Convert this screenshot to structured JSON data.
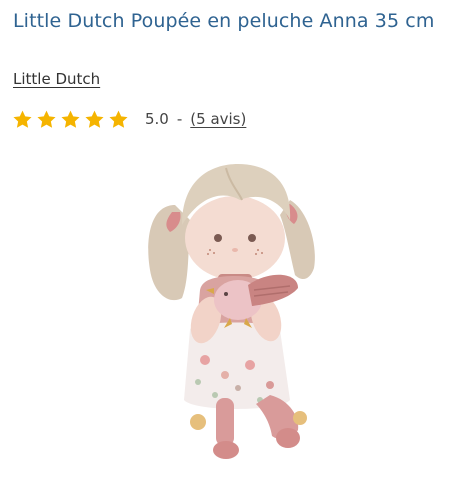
{
  "product": {
    "title": "Little Dutch Poupée en peluche Anna 35 cm",
    "brand": "Little Dutch",
    "rating": {
      "value": "5.0",
      "separator": "-",
      "reviews_label": "(5 avis)",
      "stars_filled": 5,
      "stars_total": 5
    }
  },
  "colors": {
    "title": "#2f6391",
    "star": "#f5b400",
    "text": "#444444"
  },
  "icons": {
    "star": "star-icon"
  }
}
